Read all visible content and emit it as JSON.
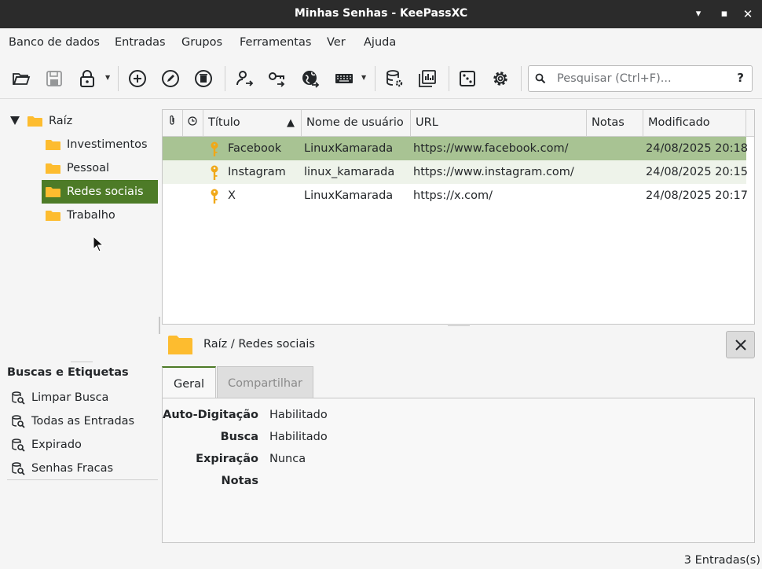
{
  "window": {
    "title": "Minhas Senhas - KeePassXC"
  },
  "menu": [
    "Banco de dados",
    "Entradas",
    "Grupos",
    "Ferramentas",
    "Ver",
    "Ajuda"
  ],
  "search": {
    "placeholder": "Pesquisar (Ctrl+F)...",
    "help": "?"
  },
  "toolbar_icons": [
    "folder-open-icon",
    "save-icon",
    "lock-icon",
    "add-entry-icon",
    "edit-entry-icon",
    "delete-entry-icon",
    "copy-username-icon",
    "copy-password-icon",
    "copy-url-icon",
    "autotype-keyboard-icon",
    "database-settings-icon",
    "reports-icon",
    "password-generator-icon",
    "settings-icon"
  ],
  "tree": {
    "root": "Raíz",
    "groups": [
      "Investimentos",
      "Pessoal",
      "Redes sociais",
      "Trabalho"
    ],
    "selected": "Redes sociais"
  },
  "tags": {
    "title": "Buscas e Etiquetas",
    "items": [
      "Limpar Busca",
      "Todas as Entradas",
      "Expirado",
      "Senhas Fracas"
    ]
  },
  "table": {
    "headers": [
      "Título",
      "Nome de usuário",
      "URL",
      "Notas",
      "Modificado"
    ],
    "rows": [
      {
        "title": "Facebook",
        "username": "LinuxKamarada",
        "url": "https://www.facebook.com/",
        "notes": "",
        "modified": "24/08/2025 20:18"
      },
      {
        "title": "Instagram",
        "username": "linux_kamarada",
        "url": "https://www.instagram.com/",
        "notes": "",
        "modified": "24/08/2025 20:15"
      },
      {
        "title": "X",
        "username": "LinuxKamarada",
        "url": "https://x.com/",
        "notes": "",
        "modified": "24/08/2025 20:17"
      }
    ]
  },
  "details": {
    "path": "Raíz / Redes sociais",
    "tabs": [
      "Geral",
      "Compartilhar"
    ],
    "fields": [
      {
        "label": "Auto-Digitação",
        "value": "Habilitado"
      },
      {
        "label": "Busca",
        "value": "Habilitado"
      },
      {
        "label": "Expiração",
        "value": "Nunca"
      },
      {
        "label": "Notas",
        "value": ""
      }
    ]
  },
  "status": "3 Entradas(s)",
  "colors": {
    "accent": "#4d7b27",
    "selected_row": "#a8c393",
    "folder": "#fdbc2f",
    "key": "#f0a818"
  }
}
